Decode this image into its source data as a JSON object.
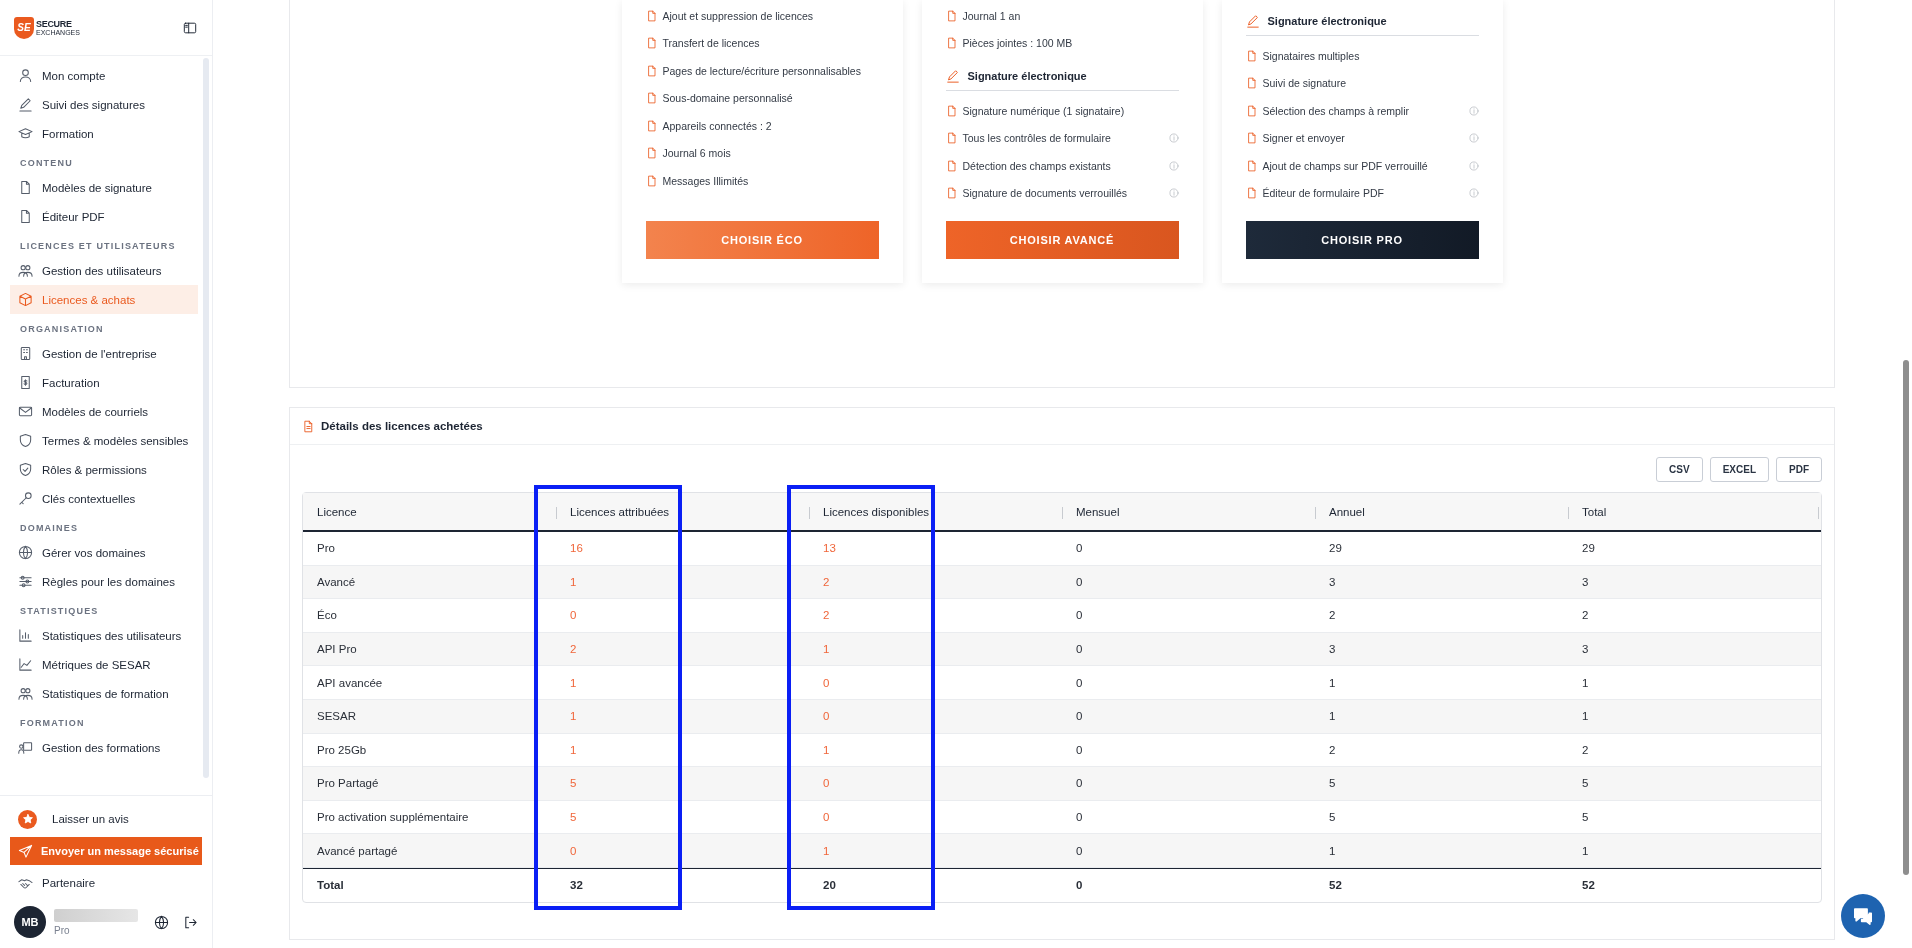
{
  "sidebar": {
    "logo": {
      "mark": "SE",
      "line1": "SECURE",
      "line2": "EXCHANGES"
    },
    "sections": [
      {
        "items": [
          {
            "label": "Mon compte",
            "selected": false
          },
          {
            "label": "Suivi des signatures",
            "selected": false
          },
          {
            "label": "Formation",
            "selected": false
          }
        ]
      },
      {
        "heading": "CONTENU",
        "items": [
          {
            "label": "Modèles de signature",
            "selected": false
          },
          {
            "label": "Éditeur PDF",
            "selected": false
          }
        ]
      },
      {
        "heading": "LICENCES ET UTILISATEURS",
        "items": [
          {
            "label": "Gestion des utilisateurs",
            "selected": false
          },
          {
            "label": "Licences & achats",
            "selected": true
          }
        ]
      },
      {
        "heading": "ORGANISATION",
        "items": [
          {
            "label": "Gestion de l'entreprise",
            "selected": false
          },
          {
            "label": "Facturation",
            "selected": false
          },
          {
            "label": "Modèles de courriels",
            "selected": false
          },
          {
            "label": "Termes & modèles sensibles",
            "selected": false
          },
          {
            "label": "Rôles & permissions",
            "selected": false
          },
          {
            "label": "Clés contextuelles",
            "selected": false
          }
        ]
      },
      {
        "heading": "DOMAINES",
        "items": [
          {
            "label": "Gérer vos domaines",
            "selected": false
          },
          {
            "label": "Règles pour les domaines",
            "selected": false
          }
        ]
      },
      {
        "heading": "STATISTIQUES",
        "items": [
          {
            "label": "Statistiques des utilisateurs",
            "selected": false
          },
          {
            "label": "Métriques de SESAR",
            "selected": false
          },
          {
            "label": "Statistiques de formation",
            "selected": false
          }
        ]
      },
      {
        "heading": "FORMATION",
        "items": [
          {
            "label": "Gestion des formations",
            "selected": false
          }
        ]
      }
    ],
    "footer": {
      "review": "Laisser un avis",
      "send_button": "Envoyer un message sécurisé",
      "partner": "Partenaire",
      "user": {
        "initials": "MB",
        "plan": "Pro"
      }
    }
  },
  "plans": [
    {
      "rows": [
        {
          "kind": "feature",
          "label": "Ajout et suppression de licences",
          "info": false
        },
        {
          "kind": "feature",
          "label": "Transfert de licences",
          "info": false
        },
        {
          "kind": "feature",
          "label": "Pages de lecture/écriture personnalisables",
          "info": false
        },
        {
          "kind": "feature",
          "label": "Sous-domaine personnalisé",
          "info": false
        },
        {
          "kind": "feature",
          "label": "Appareils connectés : 2",
          "info": false
        },
        {
          "kind": "feature",
          "label": "Journal 6 mois",
          "info": false
        },
        {
          "kind": "feature",
          "label": "Messages Illimités",
          "info": false
        }
      ],
      "button": {
        "label": "CHOISIR ÉCO"
      }
    },
    {
      "rows": [
        {
          "kind": "feature",
          "label": "Journal 1 an",
          "info": false
        },
        {
          "kind": "feature",
          "label": "Pièces jointes : 100 MB",
          "info": false
        },
        {
          "kind": "heading",
          "label": "Signature électronique"
        },
        {
          "kind": "feature",
          "label": "Signature numérique (1 signataire)",
          "info": false
        },
        {
          "kind": "feature",
          "label": "Tous les contrôles de formulaire",
          "info": true
        },
        {
          "kind": "feature",
          "label": "Détection des champs existants",
          "info": true
        },
        {
          "kind": "feature",
          "label": "Signature de documents verrouillés",
          "info": true
        }
      ],
      "button": {
        "label": "CHOISIR AVANCÉ"
      }
    },
    {
      "rows": [
        {
          "kind": "heading",
          "label": "Signature électronique"
        },
        {
          "kind": "feature",
          "label": "Signataires multiples",
          "info": false
        },
        {
          "kind": "feature",
          "label": "Suivi de signature",
          "info": false
        },
        {
          "kind": "feature",
          "label": "Sélection des champs à remplir",
          "info": true
        },
        {
          "kind": "feature",
          "label": "Signer et envoyer",
          "info": true
        },
        {
          "kind": "feature",
          "label": "Ajout de champs sur PDF verrouillé",
          "info": true
        },
        {
          "kind": "feature",
          "label": "Éditeur de formulaire PDF",
          "info": true
        }
      ],
      "button": {
        "label": "CHOISIR PRO"
      }
    }
  ],
  "details": {
    "title": "Détails des licences achetées",
    "exports": [
      "CSV",
      "EXCEL",
      "PDF"
    ],
    "table": {
      "columns": [
        {
          "label": "Licence",
          "accent": false,
          "highlighted": false
        },
        {
          "label": "Licences attribuées",
          "accent": true,
          "highlighted": true
        },
        {
          "label": "Licences disponibles",
          "accent": true,
          "highlighted": true
        },
        {
          "label": "Mensuel",
          "accent": false,
          "highlighted": false
        },
        {
          "label": "Annuel",
          "accent": false,
          "highlighted": false
        },
        {
          "label": "Total",
          "accent": false,
          "highlighted": false
        }
      ],
      "rows": [
        {
          "cells": [
            "Pro",
            "16",
            "13",
            "0",
            "29",
            "29"
          ]
        },
        {
          "cells": [
            "Avancé",
            "1",
            "2",
            "0",
            "3",
            "3"
          ]
        },
        {
          "cells": [
            "Éco",
            "0",
            "2",
            "0",
            "2",
            "2"
          ]
        },
        {
          "cells": [
            "API Pro",
            "2",
            "1",
            "0",
            "3",
            "3"
          ]
        },
        {
          "cells": [
            "API avancée",
            "1",
            "0",
            "0",
            "1",
            "1"
          ]
        },
        {
          "cells": [
            "SESAR",
            "1",
            "0",
            "0",
            "1",
            "1"
          ]
        },
        {
          "cells": [
            "Pro 25Gb",
            "1",
            "1",
            "0",
            "2",
            "2"
          ]
        },
        {
          "cells": [
            "Pro Partagé",
            "5",
            "0",
            "0",
            "5",
            "5"
          ]
        },
        {
          "cells": [
            "Pro activation supplémentaire",
            "5",
            "0",
            "0",
            "5",
            "5"
          ]
        },
        {
          "cells": [
            "Avancé partagé",
            "0",
            "1",
            "0",
            "1",
            "1"
          ]
        }
      ],
      "total_row": {
        "cells": [
          "Total",
          "32",
          "20",
          "0",
          "52",
          "52"
        ]
      }
    }
  }
}
